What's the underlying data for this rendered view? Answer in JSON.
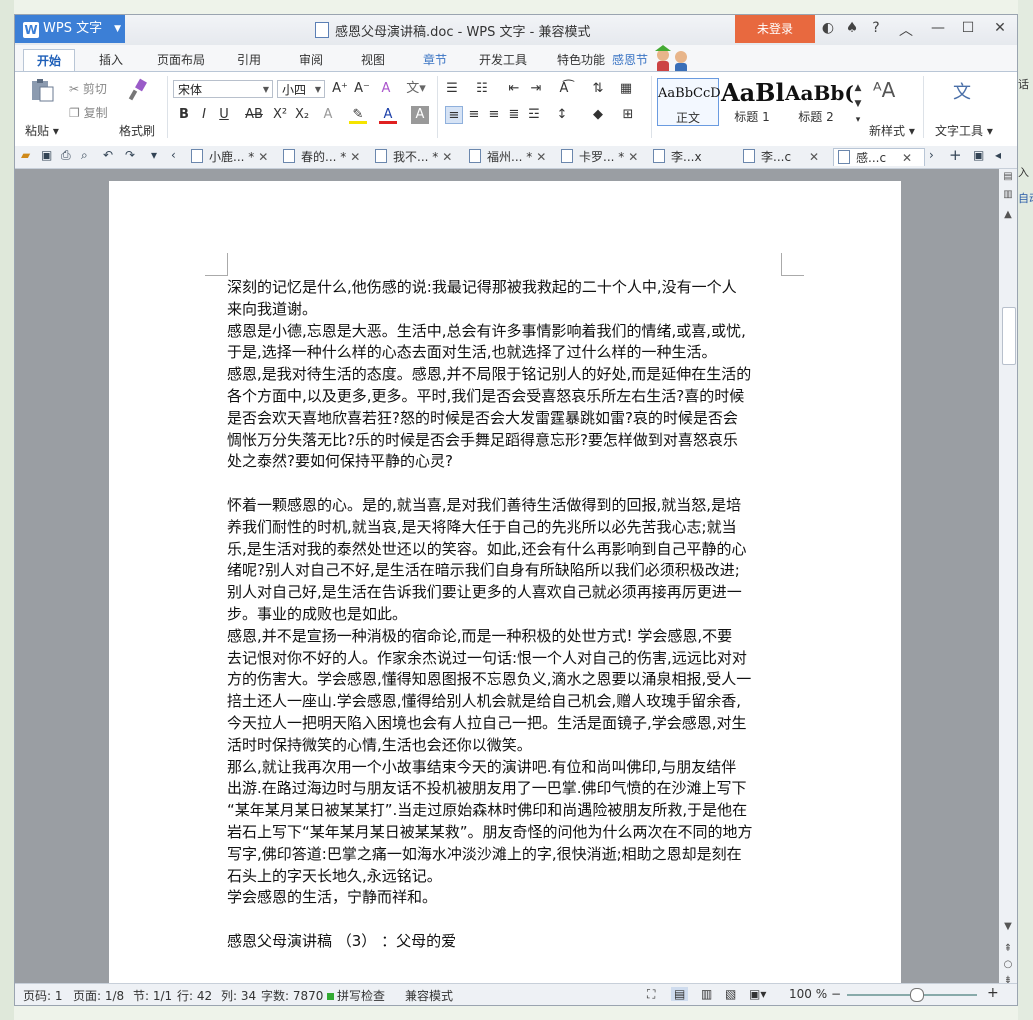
{
  "app": {
    "name": "WPS 文字",
    "doc_title": "感恩父母演讲稿.doc - WPS 文字 - 兼容模式",
    "login": "未登录"
  },
  "tabs": [
    {
      "label": "开始",
      "active": true
    },
    {
      "label": "插入"
    },
    {
      "label": "页面布局"
    },
    {
      "label": "引用"
    },
    {
      "label": "审阅"
    },
    {
      "label": "视图"
    },
    {
      "label": "章节"
    },
    {
      "label": "开发工具"
    },
    {
      "label": "特色功能"
    },
    {
      "label": "感恩节"
    }
  ],
  "ribbon": {
    "paste": "粘贴",
    "cut": "剪切",
    "copy": "复制",
    "format_painter": "格式刷",
    "font_name": "宋体",
    "font_size": "小四",
    "styles": [
      {
        "sample": "AaBbCcD",
        "label": "正文"
      },
      {
        "sample": "AaBl",
        "label": "标题 1"
      },
      {
        "sample": "AaBb(",
        "label": "标题 2"
      }
    ],
    "new_style": "新样式",
    "text_tools": "文字工具"
  },
  "doc_tabs": [
    {
      "label": "小鹿... *"
    },
    {
      "label": "春的... *"
    },
    {
      "label": "我不... *"
    },
    {
      "label": "福州... *"
    },
    {
      "label": "卡罗... *"
    },
    {
      "label": "李...x"
    },
    {
      "label": "李...c"
    },
    {
      "label": "感...c",
      "active": true
    }
  ],
  "document": {
    "lines": [
      "深刻的记忆是什么,他伤感的说:我最记得那被我救起的二十个人中,没有一个人",
      "来向我道谢。",
      "感恩是小德,忘恩是大恶。生活中,总会有许多事情影响着我们的情绪,或喜,或忧,",
      "于是,选择一种什么样的心态去面对生活,也就选择了过什么样的一种生活。",
      "感恩,是我对待生活的态度。感恩,并不局限于铭记别人的好处,而是延伸在生活的",
      "各个方面中,以及更多,更多。平时,我们是否会受喜怒哀乐所左右生活?喜的时候",
      "是否会欢天喜地欣喜若狂?怒的时候是否会大发雷霆暴跳如雷?哀的时候是否会",
      "惆怅万分失落无比?乐的时候是否会手舞足蹈得意忘形?要怎样做到对喜怒哀乐",
      "处之泰然?要如何保持平静的心灵?",
      "",
      "怀着一颗感恩的心。是的,就当喜,是对我们善待生活做得到的回报,就当怒,是培",
      "养我们耐性的时机,就当哀,是天将降大任于自己的先兆所以必先苦我心志;就当",
      "乐,是生活对我的泰然处世还以的笑容。如此,还会有什么再影响到自己平静的心",
      "绪呢?别人对自己不好,是生活在暗示我们自身有所缺陷所以我们必须积极改进;",
      "别人对自己好,是生活在告诉我们要让更多的人喜欢自己就必须再接再厉更进一",
      "步。事业的成败也是如此。",
      "感恩,并不是宣扬一种消极的宿命论,而是一种积极的处世方式! 学会感恩,不要",
      "去记恨对你不好的人。作家余杰说过一句话:恨一个人对自己的伤害,远远比对对",
      "方的伤害大。学会感恩,懂得知恩图报不忘恩负义,滴水之恩要以涌泉相报,受人一",
      "掊土还人一座山.学会感恩,懂得给别人机会就是给自己机会,赠人玫瑰手留余香,",
      "今天拉人一把明天陷入困境也会有人拉自己一把。生活是面镜子,学会感恩,对生",
      "活时时保持微笑的心情,生活也会还你以微笑。",
      "那么,就让我再次用一个小故事结束今天的演讲吧.有位和尚叫佛印,与朋友结伴",
      "出游.在路过海边时与朋友话不投机被朋友用了一巴掌.佛印气愤的在沙滩上写下",
      "“某年某月某日被某某打”.当走过原始森林时佛印和尚遇险被朋友所救,于是他在",
      "岩石上写下“某年某月某日被某某救”。朋友奇怪的问他为什么两次在不同的地方",
      "写字,佛印答道:巴掌之痛一如海水冲淡沙滩上的字,很快消逝;相助之恩却是刻在",
      "石头上的字天长地久,永远铭记。",
      "学会感恩的生活，宁静而祥和。",
      "",
      "感恩父母演讲稿 （3） ：父母的爱"
    ]
  },
  "status": {
    "page": "页码: 1",
    "pages": "页面: 1/8",
    "section": "节: 1/1",
    "row": "行: 42",
    "col": "列: 34",
    "words": "字数: 7870",
    "spell": "拼写检查",
    "compat": "兼容模式",
    "zoom": "100 %"
  },
  "bg_right": [
    "入",
    "自动",
    "话"
  ],
  "colors": {
    "accent": "#3c7fd6",
    "login": "#e8693f",
    "canvas": "#9a9ea3"
  }
}
